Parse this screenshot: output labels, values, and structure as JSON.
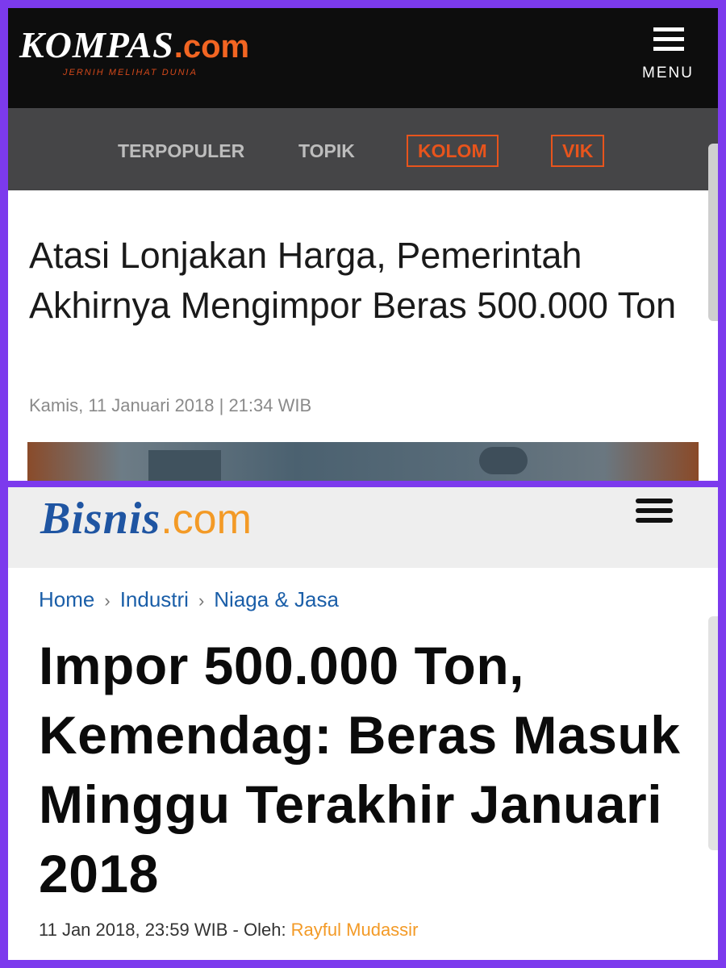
{
  "kompas": {
    "logo_name": "KOMPAS",
    "logo_suffix": ".com",
    "tagline": "JERNIH MELIHAT DUNIA",
    "menu_label": "MENU",
    "nav": [
      "TERPOPULER",
      "TOPIK",
      "KOLOM",
      "VIK"
    ],
    "headline": "Atasi Lonjakan Harga, Pemerintah Akhirnya Mengimpor Beras 500.000 Ton",
    "date": "Kamis, 11 Januari 2018 | 21:34 WIB"
  },
  "bisnis": {
    "logo_name": "Bisnis",
    "logo_suffix": ".com",
    "breadcrumb": [
      "Home",
      "Industri",
      "Niaga & Jasa"
    ],
    "headline": "Impor 500.000 Ton, Kemendag: Beras Masuk Minggu Terakhir Januari 2018",
    "date": "11 Jan 2018, 23:59 WIB",
    "author_prefix": " - Oleh: ",
    "author": "Rayful Mudassir"
  },
  "colors": {
    "frame": "#7c3aed",
    "kompas_accent": "#f26522",
    "bisnis_blue": "#1f55a2",
    "bisnis_orange": "#f39a26"
  },
  "icons": [
    "hamburger-menu-icon",
    "chevron-right-icon"
  ]
}
